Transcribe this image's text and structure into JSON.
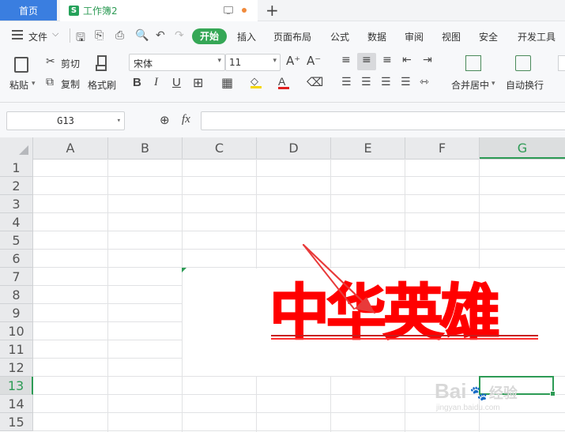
{
  "tabs": {
    "home": "首页",
    "doc": "工作簿2",
    "new_tab": "+"
  },
  "menu": [
    "文件",
    "开始",
    "插入",
    "页面布局",
    "公式",
    "数据",
    "审阅",
    "视图",
    "安全",
    "开发工具"
  ],
  "ribbon": {
    "paste": "粘贴",
    "cut": "剪切",
    "copy": "复制",
    "format_painter": "格式刷",
    "font_name": "宋体",
    "font_size": "11",
    "merge_center": "合并居中",
    "auto_wrap": "自动换行",
    "grow_font": "A⁺",
    "shrink_font": "A⁻"
  },
  "formula_bar": {
    "name_box": "G13",
    "fx": "fx",
    "value": ""
  },
  "columns": [
    "A",
    "B",
    "C",
    "D",
    "E",
    "F",
    "G"
  ],
  "rows": [
    "1",
    "2",
    "3",
    "4",
    "5",
    "6",
    "7",
    "8",
    "9",
    "10",
    "11",
    "12",
    "13",
    "14",
    "15"
  ],
  "active_cell": "G13",
  "wordart": {
    "text": "中华英雄",
    "color": "#ff0000"
  },
  "watermark": {
    "brand": "Bai",
    "brand2": "经验",
    "url": "jingyan.baidu.com"
  },
  "colors": {
    "accent": "#35a756",
    "home_tab": "#3a7ee0",
    "selection": "#2d9b55"
  }
}
